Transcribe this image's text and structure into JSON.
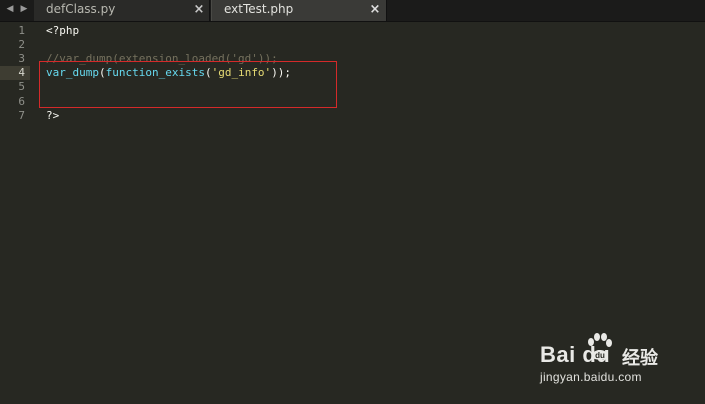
{
  "tabs": [
    {
      "label": "defClass.py",
      "close_glyph": "×",
      "active": false
    },
    {
      "label": "extTest.php",
      "close_glyph": "×",
      "active": true
    }
  ],
  "nav": {
    "left_glyph": "◀",
    "right_glyph": "▶"
  },
  "editor": {
    "current_line": 4,
    "lines": [
      {
        "number": "1",
        "tokens": [
          {
            "text": "<?php",
            "type": "plain"
          }
        ]
      },
      {
        "number": "2",
        "tokens": []
      },
      {
        "number": "3",
        "tokens": [
          {
            "text": "//var_dump(extension_loaded('gd'));",
            "type": "comment"
          }
        ]
      },
      {
        "number": "4",
        "tokens": [
          {
            "text": "var_dump",
            "type": "func"
          },
          {
            "text": "(",
            "type": "plain"
          },
          {
            "text": "function_exists",
            "type": "func"
          },
          {
            "text": "(",
            "type": "plain"
          },
          {
            "text": "'gd_info'",
            "type": "string"
          },
          {
            "text": "));",
            "type": "plain"
          }
        ]
      },
      {
        "number": "5",
        "tokens": []
      },
      {
        "number": "6",
        "tokens": []
      },
      {
        "number": "7",
        "tokens": [
          {
            "text": "?>",
            "type": "plain"
          }
        ]
      }
    ]
  },
  "watermark": {
    "brand": "Bai  du",
    "cn": "经验",
    "url": "jingyan.baidu.com"
  },
  "colors": {
    "background": "#272822",
    "comment": "#75715e",
    "function": "#66d9ef",
    "string": "#e6db74",
    "highlight_box": "#d42a2a"
  }
}
